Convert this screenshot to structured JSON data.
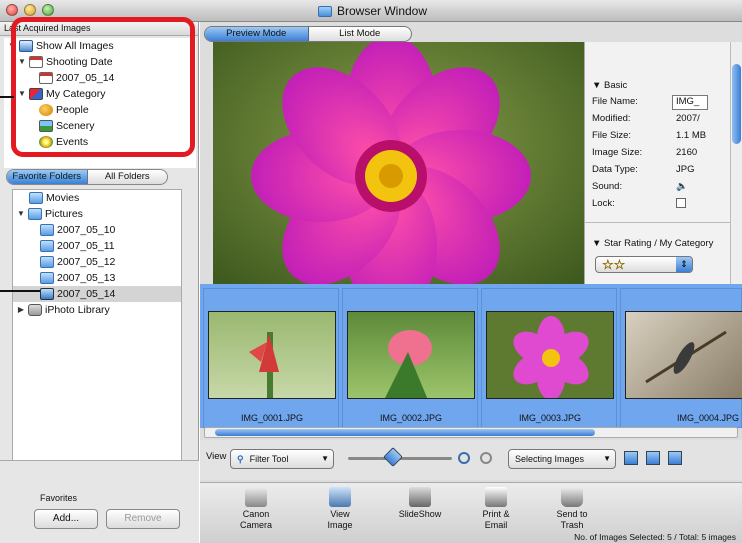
{
  "window": {
    "title": "Browser Window"
  },
  "last_acquired": {
    "header": "Last Acquired Images",
    "items": [
      {
        "label": "Show All Images",
        "level": 0
      },
      {
        "label": "Shooting Date",
        "level": 1
      },
      {
        "label": "2007_05_14",
        "level": 2
      },
      {
        "label": "My Category",
        "level": 1
      },
      {
        "label": "People",
        "level": 2
      },
      {
        "label": "Scenery",
        "level": 2
      },
      {
        "label": "Events",
        "level": 2
      }
    ]
  },
  "folder_tabs": {
    "favorite": "Favorite Folders",
    "all": "All Folders"
  },
  "folders": {
    "items": [
      {
        "label": "Movies"
      },
      {
        "label": "Pictures"
      },
      {
        "label": "2007_05_10"
      },
      {
        "label": "2007_05_11"
      },
      {
        "label": "2007_05_12"
      },
      {
        "label": "2007_05_13"
      },
      {
        "label": "2007_05_14"
      },
      {
        "label": "iPhoto Library"
      }
    ]
  },
  "favorites": {
    "label": "Favorites",
    "add": "Add...",
    "remove": "Remove"
  },
  "modes": {
    "preview": "Preview Mode",
    "list": "List Mode"
  },
  "info": {
    "section_basic": "Basic",
    "rows": [
      {
        "label": "File Name:",
        "value": "IMG_"
      },
      {
        "label": "Modified:",
        "value": "2007/"
      },
      {
        "label": "File Size:",
        "value": "1.1 MB"
      },
      {
        "label": "Image Size:",
        "value": "2160"
      },
      {
        "label": "Data Type:",
        "value": "JPG"
      },
      {
        "label": "Sound:",
        "value": ""
      },
      {
        "label": "Lock:",
        "value": ""
      }
    ],
    "section_rating": "Star Rating / My Category",
    "rating_stars": 2
  },
  "thumbnails": [
    {
      "name": "IMG_0001.JPG"
    },
    {
      "name": "IMG_0002.JPG"
    },
    {
      "name": "IMG_0003.JPG"
    },
    {
      "name": "IMG_0004.JPG"
    }
  ],
  "controls": {
    "view_label": "View",
    "filter_tool": "Filter Tool",
    "selecting_images": "Selecting Images"
  },
  "tools": [
    {
      "label": "Canon\nCamera"
    },
    {
      "label": "View\nImage"
    },
    {
      "label": "SlideShow"
    },
    {
      "label": "Print &\nEmail"
    },
    {
      "label": "Send to\nTrash"
    }
  ],
  "status": "No. of Images Selected: 5 / Total: 5 images",
  "colors": {
    "highlight_red": "#e21b22",
    "selection_blue": "#6fa6ee"
  }
}
